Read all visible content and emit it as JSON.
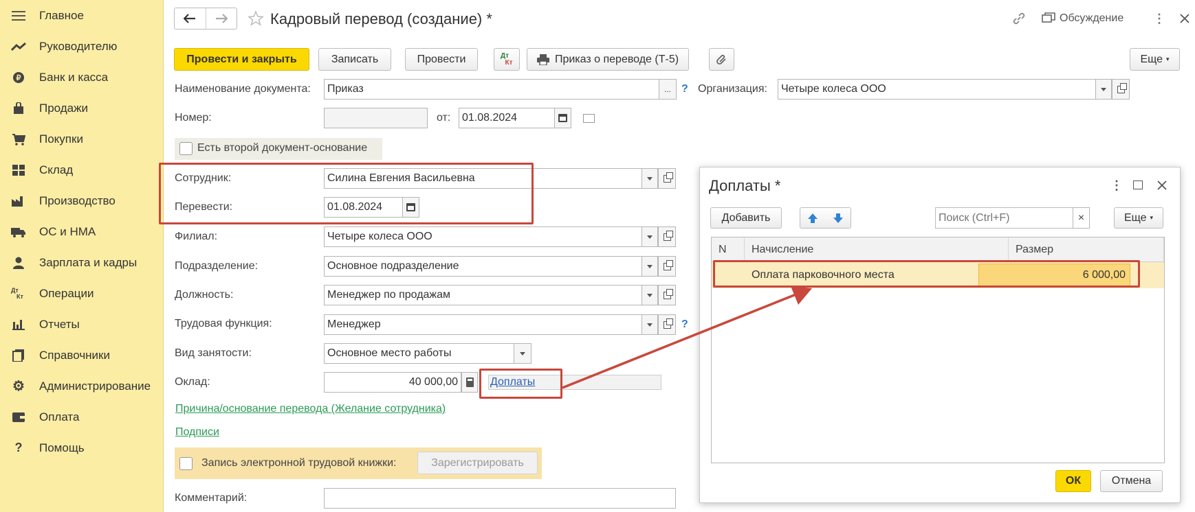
{
  "sidebar": {
    "items": [
      {
        "label": "Главное",
        "icon": "menu-icon"
      },
      {
        "label": "Руководителю",
        "icon": "trend-icon"
      },
      {
        "label": "Банк и касса",
        "icon": "coin-icon"
      },
      {
        "label": "Продажи",
        "icon": "bag-icon"
      },
      {
        "label": "Покупки",
        "icon": "cart-icon"
      },
      {
        "label": "Склад",
        "icon": "warehouse-icon"
      },
      {
        "label": "Производство",
        "icon": "factory-icon"
      },
      {
        "label": "ОС и НМА",
        "icon": "truck-icon"
      },
      {
        "label": "Зарплата и кадры",
        "icon": "person-icon"
      },
      {
        "label": "Операции",
        "icon": "dt-kt-icon"
      },
      {
        "label": "Отчеты",
        "icon": "bar-chart-icon"
      },
      {
        "label": "Справочники",
        "icon": "books-icon"
      },
      {
        "label": "Администрирование",
        "icon": "gear-icon"
      },
      {
        "label": "Оплата",
        "icon": "wallet-icon"
      },
      {
        "label": "Помощь",
        "icon": "help-icon"
      }
    ]
  },
  "header": {
    "title": "Кадровый перевод (создание) *",
    "discussion": "Обсуждение"
  },
  "toolbar": {
    "post_close": "Провести и закрыть",
    "save": "Записать",
    "post": "Провести",
    "dt": "Дт",
    "kt": "Кт",
    "order": "Приказ о переводе (Т-5)",
    "more": "Еще"
  },
  "form": {
    "doc_name_label": "Наименование документа:",
    "doc_name_value": "Приказ",
    "dots": "...",
    "q": "?",
    "org_label": "Организация:",
    "org_value": "Четыре колеса ООО",
    "number_label": "Номер:",
    "number_value": "",
    "from_label": "от:",
    "date_value": "01.08.2024",
    "second_doc": "Есть второй документ-основание",
    "employee_label": "Сотрудник:",
    "employee_value": "Силина Евгения Васильевна",
    "transfer_label": "Перевести:",
    "transfer_date": "01.08.2024",
    "branch_label": "Филиал:",
    "branch_value": "Четыре колеса ООО",
    "division_label": "Подразделение:",
    "division_value": "Основное подразделение",
    "position_label": "Должность:",
    "position_value": "Менеджер по продажам",
    "function_label": "Трудовая функция:",
    "function_value": "Менеджер",
    "employment_label": "Вид занятости:",
    "employment_value": "Основное место работы",
    "salary_label": "Оклад:",
    "salary_value": "40 000,00",
    "allowances_link": "Доплаты",
    "reason_link": "Причина/основание перевода (Желание сотрудника)",
    "signatures_link": "Подписи",
    "etk_label": "Запись электронной трудовой книжки:",
    "register_btn": "Зарегистрировать",
    "comment_label": "Комментарий:",
    "comment_value": ""
  },
  "dialog": {
    "title": "Доплаты *",
    "add": "Добавить",
    "search_placeholder": "Поиск (Ctrl+F)",
    "clear": "×",
    "more": "Еще",
    "col_n": "N",
    "col_accrual": "Начисление",
    "col_amount": "Размер",
    "rows": [
      {
        "n": "",
        "accrual": "Оплата парковочного места",
        "amount": "6 000,00"
      }
    ],
    "ok": "ОК",
    "cancel": "Отмена"
  },
  "colors": {
    "sidebar_bg": "#fbeda4",
    "primary_button": "#fbd800",
    "highlight": "#c9473c",
    "selected_row": "#fbedc0",
    "link_green": "#2b9b56",
    "link_blue": "#2b5fb4"
  }
}
